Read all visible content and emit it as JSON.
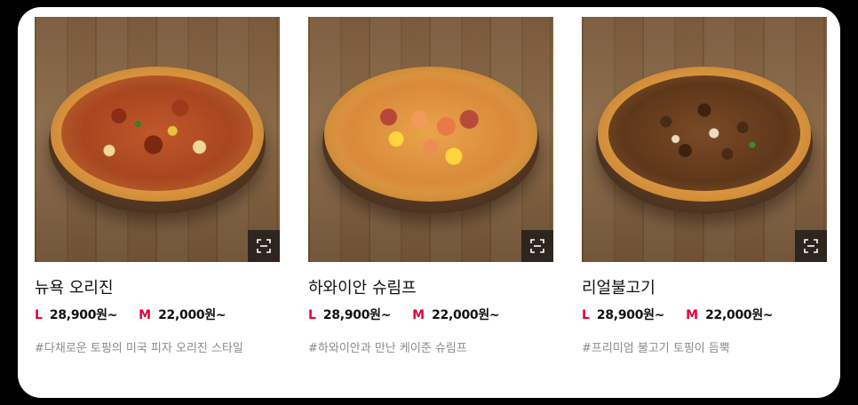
{
  "products": [
    {
      "name": "뉴욕 오리진",
      "price_l_label": "L",
      "price_l": "28,900원~",
      "price_m_label": "M",
      "price_m": "22,000원~",
      "tagline": "#다채로운 토핑의 미국 피자 오리진 스타일"
    },
    {
      "name": "하와이안 슈림프",
      "price_l_label": "L",
      "price_l": "28,900원~",
      "price_m_label": "M",
      "price_m": "22,000원~",
      "tagline": "#하와이안과 만난 케이준 슈림프"
    },
    {
      "name": "리얼불고기",
      "price_l_label": "L",
      "price_l": "28,900원~",
      "price_m_label": "M",
      "price_m": "22,000원~",
      "tagline": "#프리미엄 불고기 토핑이 듬뿍"
    }
  ],
  "colors": {
    "size_label": "#e4003a",
    "name_text": "#111111",
    "tagline_text": "#8a8a8a",
    "zoom_button_bg": "#28221e"
  },
  "icons": {
    "zoom": "expand-icon"
  }
}
